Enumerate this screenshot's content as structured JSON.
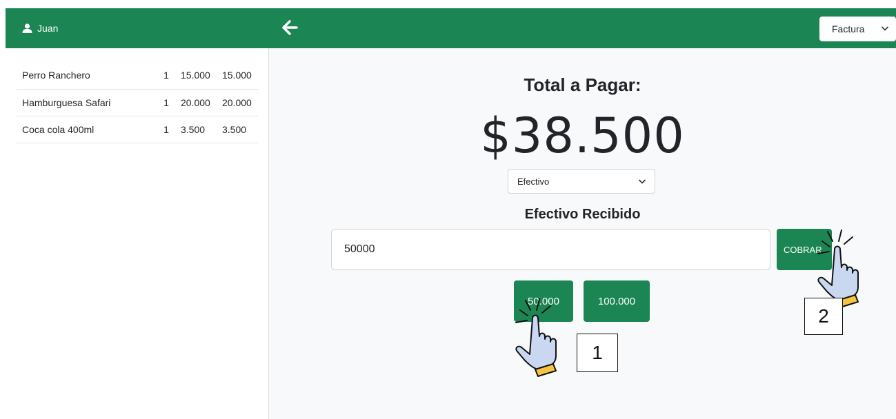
{
  "user": {
    "name": "Juan",
    "icon": "user-icon"
  },
  "order": {
    "items": [
      {
        "name": "Perro Ranchero",
        "qty": "1",
        "price": "15.000",
        "total": "15.000"
      },
      {
        "name": "Hamburguesa Safari",
        "qty": "1",
        "price": "20.000",
        "total": "20.000"
      },
      {
        "name": "Coca cola 400ml",
        "qty": "1",
        "price": "3.500",
        "total": "3.500"
      }
    ]
  },
  "header": {
    "back_icon": "arrow-left-icon",
    "document_type": "Factura"
  },
  "payment": {
    "title": "Total a Pagar:",
    "amount": "$38.500",
    "method": "Efectivo",
    "cash_label": "Efectivo Recibido",
    "cash_value": "50000",
    "charge_label": "COBRAR",
    "quick_amounts": [
      "50.000",
      "100.000"
    ]
  },
  "annotations": {
    "step_1": "1",
    "step_2": "2"
  },
  "colors": {
    "brand_green": "#1b8654",
    "background": "#f8f9fa"
  }
}
